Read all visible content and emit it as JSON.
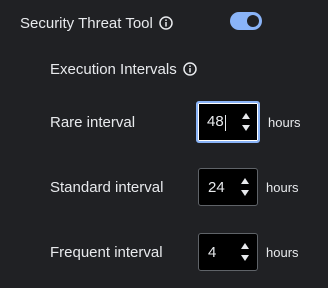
{
  "header": {
    "title": "Security Threat Tool",
    "info_icon": "info-icon",
    "toggle_enabled": true
  },
  "section": {
    "title": "Execution Intervals",
    "info_icon": "info-icon"
  },
  "intervals": [
    {
      "label": "Rare interval",
      "value": "48",
      "unit": "hours",
      "focused": true
    },
    {
      "label": "Standard interval",
      "value": "24",
      "unit": "hours",
      "focused": false
    },
    {
      "label": "Frequent interval",
      "value": "4",
      "unit": "hours",
      "focused": false
    }
  ],
  "colors": {
    "background": "#202124",
    "accent": "#8ab4f8",
    "text": "#e8eaed",
    "input_bg": "#000000"
  }
}
